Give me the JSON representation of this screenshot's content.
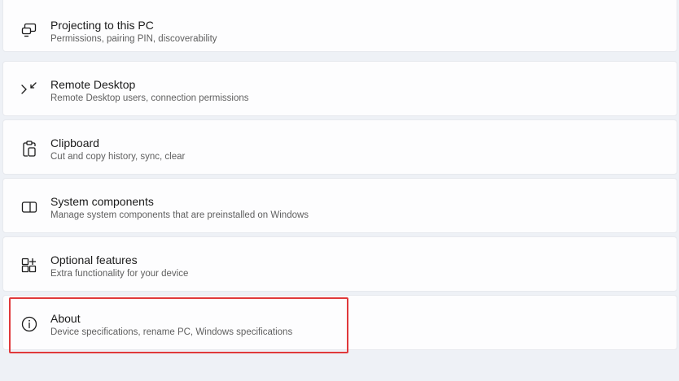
{
  "items": [
    {
      "title": "Projecting to this PC",
      "subtitle": "Permissions, pairing PIN, discoverability",
      "icon": "projecting-icon"
    },
    {
      "title": "Remote Desktop",
      "subtitle": "Remote Desktop users, connection permissions",
      "icon": "remote-desktop-icon"
    },
    {
      "title": "Clipboard",
      "subtitle": "Cut and copy history, sync, clear",
      "icon": "clipboard-icon"
    },
    {
      "title": "System components",
      "subtitle": "Manage system components that are preinstalled on Windows",
      "icon": "system-components-icon"
    },
    {
      "title": "Optional features",
      "subtitle": "Extra functionality for your device",
      "icon": "optional-features-icon"
    },
    {
      "title": "About",
      "subtitle": "Device specifications, rename PC, Windows specifications",
      "icon": "info-icon"
    }
  ],
  "colors": {
    "background": "#eef1f6",
    "card": "#fdfdfe",
    "highlight": "#e0393b"
  }
}
